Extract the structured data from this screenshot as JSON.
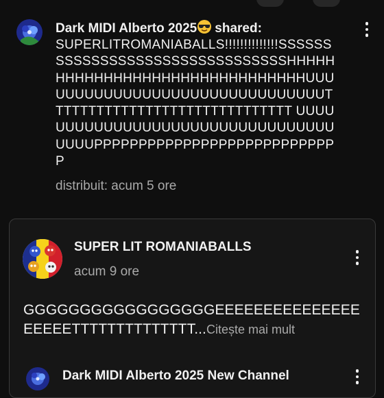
{
  "post": {
    "author": "Dark MIDI Alberto 2025",
    "author_emoji": "smiling-face-with-sunglasses-icon",
    "action": "shared:",
    "text": "SUPERLITROMANIABALLS!!!!!!!!!!!!!!SSSSSSSSSSSSSSSSSSSSSSSSSSSSSSSSHHHHHHHHHHHHHHHHHHHHHHHHHHHHHHHUUUUUUUUUUUUUUUUUUUUUUUUUUUUUUUTTTTTTTTTTTTTTTTTTTTTTTTTTTTTT UUUUUUUUUUUUUUUUUUUUUUUUUUUUUUUUUUUUUPPPPPPPPPPPPPPPPPPPPPPPPPPPP",
    "shared_time": "distribuit: acum 5 ore"
  },
  "shared_post": {
    "author": "SUPER LIT ROMANIABALLS",
    "time": "acum 9 ore",
    "text": "GGGGGGGGGGGGGGGGGEEEEEEEEEEEEEEEEEEEETTTTTTTTTTTTTT...",
    "read_more": "Citește mai mult"
  },
  "next_post": {
    "author": "Dark MIDI Alberto 2025 New Channel"
  },
  "colors": {
    "background": "#0f0f0f",
    "card_border": "#3a3a3a",
    "primary_text": "#f1f1f1",
    "secondary_text": "#aaaaaa"
  }
}
